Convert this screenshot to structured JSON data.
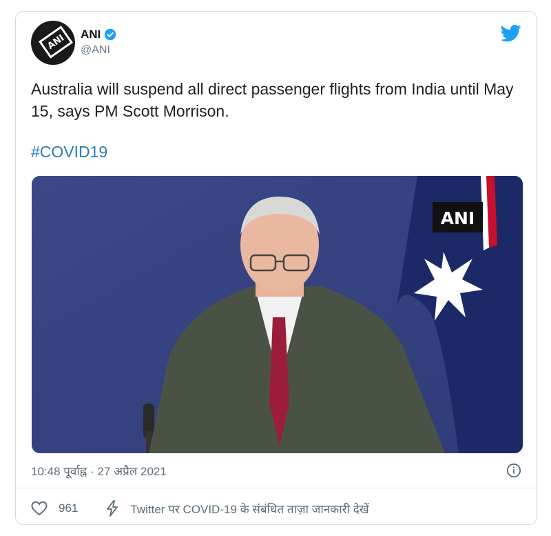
{
  "author": {
    "name": "ANI",
    "handle": "@ANI",
    "avatar_text": "ANI",
    "verified": true
  },
  "tweet": {
    "text": "Australia will suspend all direct passenger flights from India until May 15, says PM Scott Morrison.",
    "hashtag": "#COVID19"
  },
  "media": {
    "watermark": "ANI"
  },
  "meta": {
    "timestamp": "10:48 पूर्वाह्न · 27 अप्रैल 2021"
  },
  "actions": {
    "likes": "961",
    "covid_link": "Twitter पर COVID-19 के संबंधित ताज़ा जानकारी देखें"
  },
  "colors": {
    "twitter_blue": "#1da1f2",
    "link": "#2b7bb9",
    "text": "#1c2022",
    "muted": "#5b6b75"
  },
  "icons": {
    "bird": "twitter-bird-icon",
    "verified": "verified-badge-icon",
    "info": "info-icon",
    "heart": "heart-icon",
    "bolt": "lightning-bolt-icon"
  }
}
